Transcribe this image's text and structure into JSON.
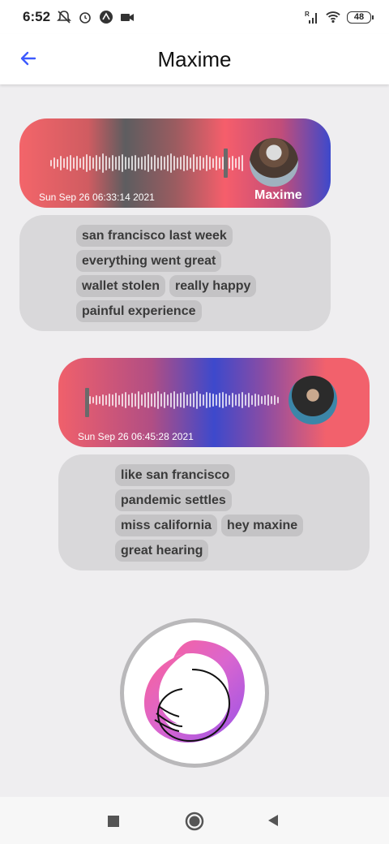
{
  "status_bar": {
    "time": "6:52",
    "icons_left": [
      "notifications-off-icon",
      "alarm-icon",
      "app-badge-icon",
      "video-icon"
    ],
    "icons_right": [
      "signal-icon",
      "wifi-icon",
      "battery-icon"
    ],
    "signal_label": "R",
    "battery": "48"
  },
  "app_bar": {
    "title": "Maxime",
    "back_icon": "arrow-left-icon",
    "accent": "#3d5afe"
  },
  "messages": [
    {
      "type": "voice",
      "timestamp": "Sun Sep 26 06:33:14 2021",
      "sender": "Maxime",
      "gradient": [
        "#f3656a",
        "#5d5d60",
        "#f65e6b",
        "#3d49cc"
      ],
      "keywords": [
        [
          "san francisco last week"
        ],
        [
          "everything went great"
        ],
        [
          "wallet stolen",
          "really happy"
        ],
        [
          "painful experience"
        ]
      ]
    },
    {
      "type": "voice",
      "timestamp": "Sun Sep 26 06:45:28 2021",
      "sender": "",
      "gradient": [
        "#f0606b",
        "#3d49cc",
        "#f2616c"
      ],
      "keywords": [
        [
          "like san francisco"
        ],
        [
          "pandemic settles"
        ],
        [
          "miss california",
          "hey maxine"
        ],
        [
          "great hearing"
        ]
      ]
    }
  ],
  "record_button": {
    "icon": "ouroboros-logo-icon"
  },
  "nav_bar": {
    "icons": [
      "recent-apps-icon",
      "home-icon",
      "back-icon"
    ]
  }
}
